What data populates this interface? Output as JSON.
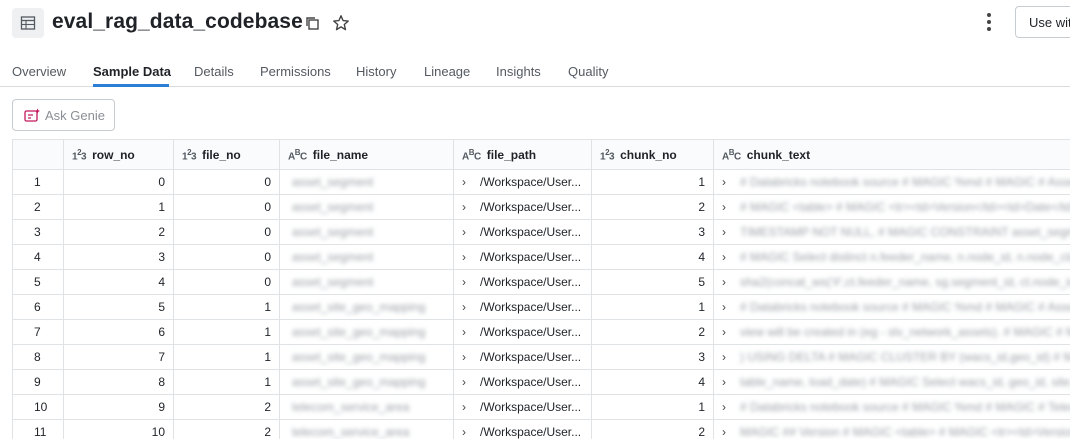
{
  "header": {
    "title": "eval_rag_data_codebase",
    "use_button_label": "Use wit"
  },
  "tabs": [
    {
      "label": "Overview"
    },
    {
      "label": "Sample Data"
    },
    {
      "label": "Details"
    },
    {
      "label": "Permissions"
    },
    {
      "label": "History"
    },
    {
      "label": "Lineage"
    },
    {
      "label": "Insights"
    },
    {
      "label": "Quality"
    }
  ],
  "active_tab": "Sample Data",
  "genie": {
    "label": "Ask Genie"
  },
  "colors": {
    "accent": "#2a7fd4",
    "genie_icon": "#c2185b"
  },
  "table": {
    "columns": [
      {
        "name": "row_no",
        "type_icon": "123"
      },
      {
        "name": "file_no",
        "type_icon": "123"
      },
      {
        "name": "file_name",
        "type_icon": "ABC"
      },
      {
        "name": "file_path",
        "type_icon": "ABC"
      },
      {
        "name": "chunk_no",
        "type_icon": "123"
      },
      {
        "name": "chunk_text",
        "type_icon": "ABC"
      }
    ],
    "rows": [
      {
        "idx": "1",
        "row_no": "0",
        "file_no": "0",
        "file_name": "asset_segment",
        "file_path": "/Workspace/User...",
        "chunk_no": "1",
        "chunk_text": "# Databricks notebook source # MAGIC %md # MAGIC # Asset"
      },
      {
        "idx": "2",
        "row_no": "1",
        "file_no": "0",
        "file_name": "asset_segment",
        "file_path": "/Workspace/User...",
        "chunk_no": "2",
        "chunk_text": "# MAGIC <table> # MAGIC <tr><td>Version</td><td>Date</td>"
      },
      {
        "idx": "3",
        "row_no": "2",
        "file_no": "0",
        "file_name": "asset_segment",
        "file_path": "/Workspace/User...",
        "chunk_no": "3",
        "chunk_text": "TIMESTAMP NOT NULL, # MAGIC CONSTRAINT asset_segment"
      },
      {
        "idx": "4",
        "row_no": "3",
        "file_no": "0",
        "file_name": "asset_segment",
        "file_path": "/Workspace/User...",
        "chunk_no": "4",
        "chunk_text": "# MAGIC Select distinct n.feeder_name, n.node_id, n.node_class"
      },
      {
        "idx": "5",
        "row_no": "4",
        "file_no": "0",
        "file_name": "asset_segment",
        "file_path": "/Workspace/User...",
        "chunk_no": "5",
        "chunk_text": "sha2(concat_ws('#',ct.feeder_name, sg.segment_id, ct.node_id"
      },
      {
        "idx": "6",
        "row_no": "5",
        "file_no": "1",
        "file_name": "asset_site_geo_mapping",
        "file_path": "/Workspace/User...",
        "chunk_no": "1",
        "chunk_text": "# Databricks notebook source # MAGIC %md # MAGIC # Asset"
      },
      {
        "idx": "7",
        "row_no": "6",
        "file_no": "1",
        "file_name": "asset_site_geo_mapping",
        "file_path": "/Workspace/User...",
        "chunk_no": "2",
        "chunk_text": "view will be created in (eg - slv_network_assets). # MAGIC # MAGIC"
      },
      {
        "idx": "8",
        "row_no": "7",
        "file_no": "1",
        "file_name": "asset_site_geo_mapping",
        "file_path": "/Workspace/User...",
        "chunk_no": "3",
        "chunk_text": ") USING DELTA # MAGIC CLUSTER BY (wacs_id,geo_id) # MAGIC"
      },
      {
        "idx": "9",
        "row_no": "8",
        "file_no": "1",
        "file_name": "asset_site_geo_mapping",
        "file_path": "/Workspace/User...",
        "chunk_no": "4",
        "chunk_text": "table_name, load_date) # MAGIC Select wacs_id, geo_id, site_ty"
      },
      {
        "idx": "10",
        "row_no": "9",
        "file_no": "2",
        "file_name": "telecom_service_area",
        "file_path": "/Workspace/User...",
        "chunk_no": "1",
        "chunk_text": "# Databricks notebook source # MAGIC %md # MAGIC # Telecom"
      },
      {
        "idx": "11",
        "row_no": "10",
        "file_no": "2",
        "file_name": "telecom_service_area",
        "file_path": "/Workspace/User...",
        "chunk_no": "2",
        "chunk_text": "MAGIC ## Version # MAGIC <table> # MAGIC <tr><td>Version"
      }
    ]
  }
}
